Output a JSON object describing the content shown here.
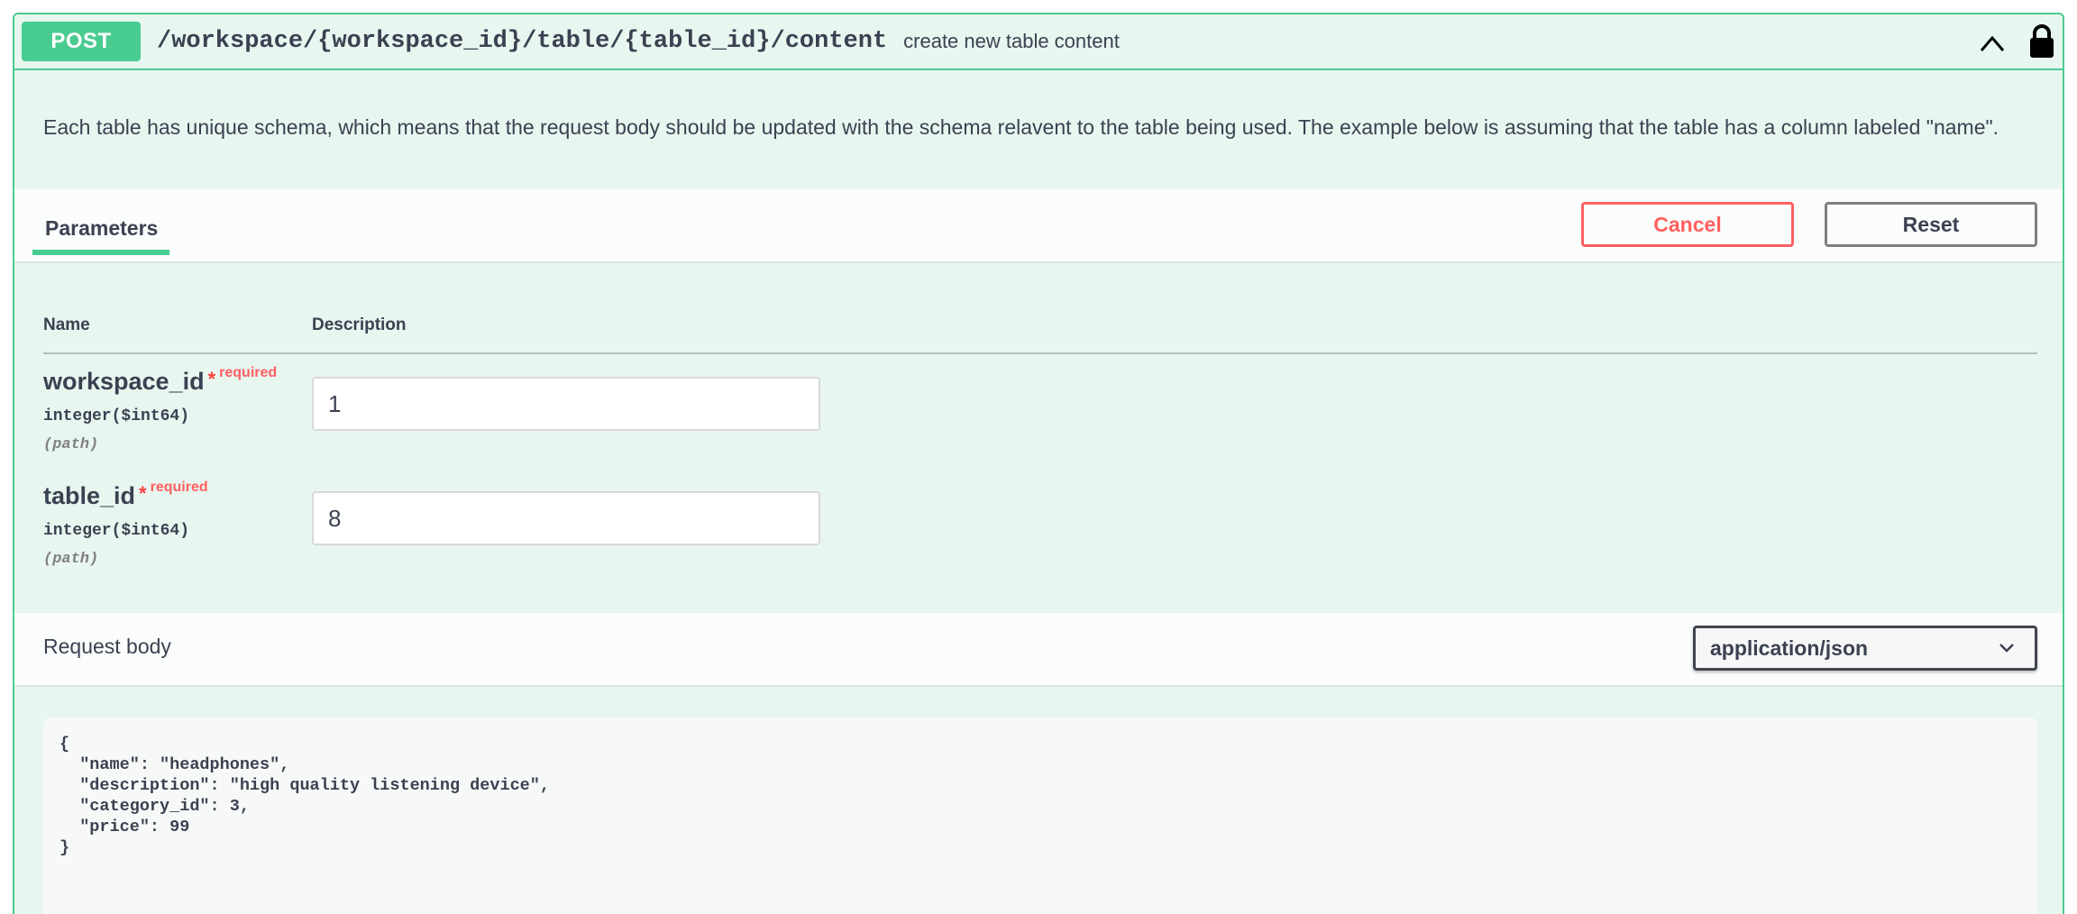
{
  "operation": {
    "method": "POST",
    "path": "/workspace/{workspace_id}/table/{table_id}/content",
    "summary": "create new table content",
    "description": "Each table has unique schema, which means that the request body should be updated with the schema relavent to the table being used. The example below is assuming that the table has a column labeled \"name\"."
  },
  "parameters_section": {
    "tab_label": "Parameters",
    "cancel_label": "Cancel",
    "reset_label": "Reset",
    "col_name": "Name",
    "col_description": "Description"
  },
  "params": [
    {
      "name": "workspace_id",
      "required_mark": "*",
      "required_label": "required",
      "type": "integer",
      "format": "($int64)",
      "in": "(path)",
      "value": "1"
    },
    {
      "name": "table_id",
      "required_mark": "*",
      "required_label": "required",
      "type": "integer",
      "format": "($int64)",
      "in": "(path)",
      "value": "8"
    }
  ],
  "request_body": {
    "label": "Request body",
    "content_type": "application/json",
    "example": "{\n  \"name\": \"headphones\",\n  \"description\": \"high quality listening device\",\n  \"category_id\": 3,\n  \"price\": 99\n}"
  },
  "colors": {
    "post_accent": "#49cc90",
    "cancel_red": "#ff6060"
  },
  "icons": {
    "collapse": "chevron-up-icon",
    "auth": "lock-icon",
    "select": "chevron-down-icon"
  }
}
